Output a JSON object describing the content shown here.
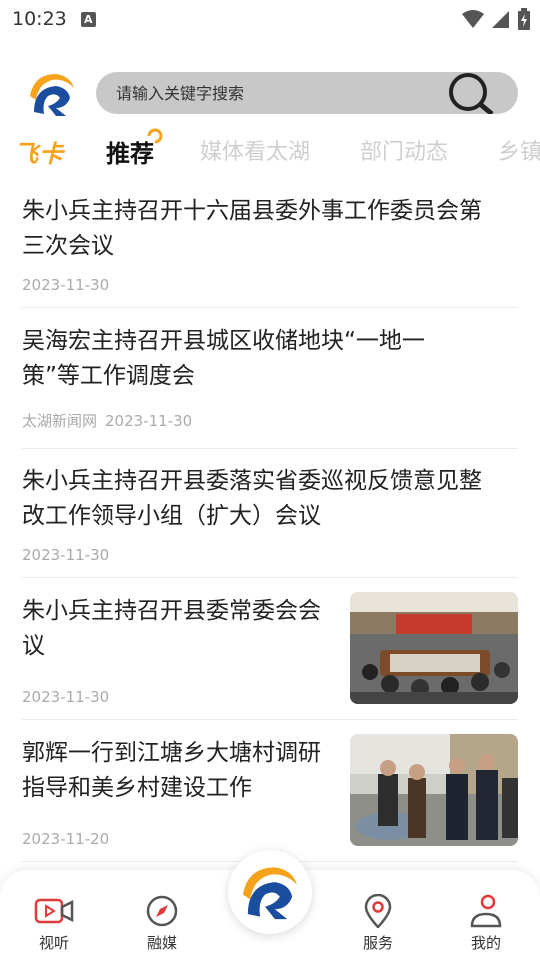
{
  "status_bar": {
    "time": "10:23",
    "a_badge": "A"
  },
  "search": {
    "placeholder": "请输入关键字搜索"
  },
  "tabs": [
    {
      "label": "飞卡"
    },
    {
      "label": "推荐",
      "active": true
    },
    {
      "label": "媒体看太湖"
    },
    {
      "label": "部门动态"
    },
    {
      "label": "乡镇"
    }
  ],
  "news": [
    {
      "title_line1": "朱小兵主持召开十六届县委外事工作委员会第",
      "title_line2": "三次会议",
      "source": "",
      "date": "2023-11-30"
    },
    {
      "title_line1": "吴海宏主持召开县城区收储地块“一地一",
      "title_line2": "策”等工作调度会",
      "source": "太湖新闻网",
      "date": "2023-11-30"
    },
    {
      "title_line1": "朱小兵主持召开县委落实省委巡视反馈意见整",
      "title_line2": "改工作领导小组（扩大）会议",
      "source": "",
      "date": "2023-11-30"
    },
    {
      "title_line1": "朱小兵主持召开县委常委会会",
      "title_line2": "议",
      "source": "",
      "date": "2023-11-30"
    },
    {
      "title_line1": "郭辉一行到江塘乡大塘村调研",
      "title_line2": "指导和美乡村建设工作",
      "source": "",
      "date": "2023-11-20"
    }
  ],
  "bottom_nav": [
    {
      "label": "视听",
      "icon": "video-icon"
    },
    {
      "label": "融媒",
      "icon": "compass-icon"
    },
    {
      "label": "",
      "icon": "logo-icon"
    },
    {
      "label": "服务",
      "icon": "location-pin-icon"
    },
    {
      "label": "我的",
      "icon": "user-icon"
    }
  ],
  "colors": {
    "accent": "#f6a21a",
    "brand_blue": "#1a4d9e",
    "nav_red": "#e03a3a"
  }
}
